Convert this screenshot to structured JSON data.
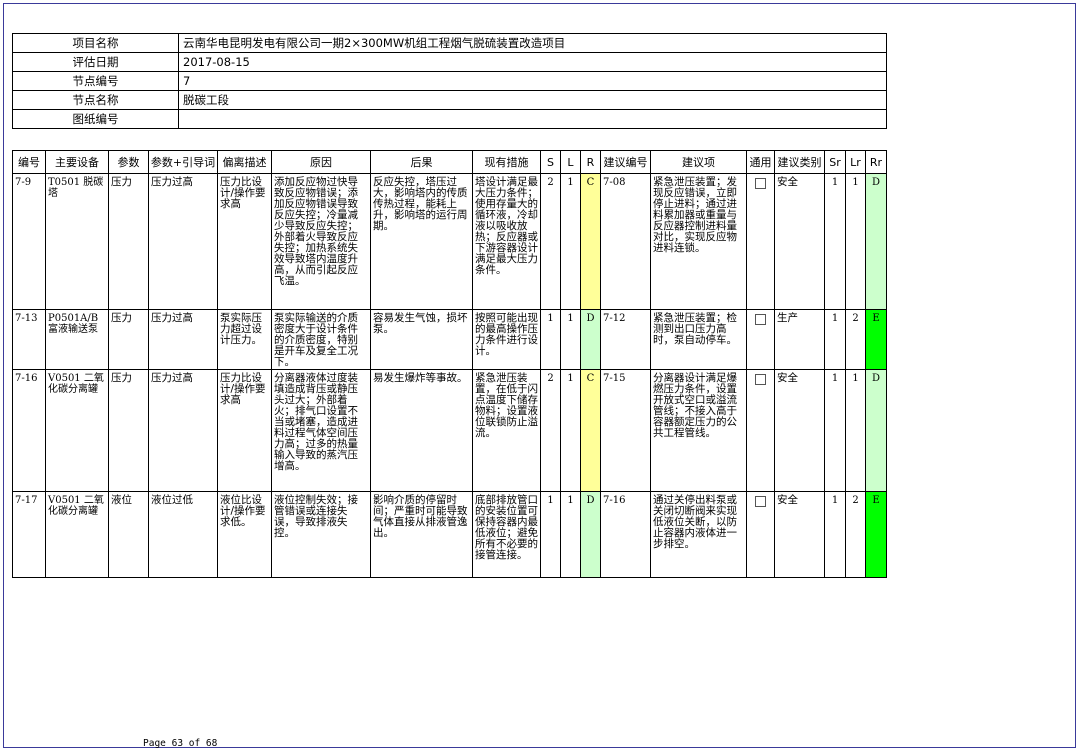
{
  "project": {
    "name_label": "项目名称",
    "name": "云南华电昆明发电有限公司一期2×300MW机组工程烟气脱硫装置改造项目",
    "date_label": "评估日期",
    "date": "2017-08-15",
    "node_no_label": "节点编号",
    "node_no": "7",
    "node_name_label": "节点名称",
    "node_name": "脱碳工段",
    "drawing_label": "图纸编号",
    "drawing": ""
  },
  "columns": [
    "编号",
    "主要设备",
    "参数",
    "参数+引导词",
    "偏离描述",
    "原因",
    "后果",
    "现有措施",
    "S",
    "L",
    "R",
    "建议编号",
    "建议项",
    "通用",
    "建议类别",
    "Sr",
    "Lr",
    "Rr"
  ],
  "rows": [
    {
      "id": "7-9",
      "equipment": "T0501 脱碳塔",
      "param": "压力",
      "param_guide": "压力过高",
      "deviation": "压力比设计/操作要求高",
      "cause": "添加反应物过快导致反应物错误；添加反应物错误导致反应失控；冷量减少导致反应失控；外部着火导致反应失控；加热系统失效导致塔内温度升高，从而引起反应飞温。",
      "consequence": "反应失控，塔压过大，影响塔内的传质传热过程，能耗上升，影响塔的运行周期。",
      "safeguards": "塔设计满足最大压力条件；使用存量大的循环液，冷却液以吸收放热；反应器或下游容器设计满足最大压力条件。",
      "s": "2",
      "l": "1",
      "r": "C",
      "rec_id": "7-08",
      "recommendation": "紧急泄压装置；发现反应错误，立即停止进料；通过进料累加器或重量与反应器控制进料量对比，实现反应物进料连锁。",
      "category": "安全",
      "sr": "1",
      "lr": "1",
      "rr": "D"
    },
    {
      "id": "7-13",
      "equipment": "P0501A/B富液输送泵",
      "param": "压力",
      "param_guide": "压力过高",
      "deviation": "泵实际压力超过设计压力。",
      "cause": "泵实际输送的介质密度大于设计条件的介质密度，特别是开车及复全工况下。",
      "consequence": "容易发生气蚀，损坏泵。",
      "safeguards": "按照可能出现的最高操作压力条件进行设计。",
      "s": "1",
      "l": "1",
      "r": "D",
      "rec_id": "7-12",
      "recommendation": "紧急泄压装置；检测到出口压力高时，泵自动停车。",
      "category": "生产",
      "sr": "1",
      "lr": "2",
      "rr": "E"
    },
    {
      "id": "7-16",
      "equipment": "V0501 二氧化碳分离罐",
      "param": "压力",
      "param_guide": "压力过高",
      "deviation": "压力比设计/操作要求高",
      "cause": "分离器液体过度装填造成背压或静压头过大；外部着火；排气口设置不当或堵塞，造成进料过程气体空间压力高；过多的热量输入导致的蒸汽压增高。",
      "consequence": "易发生爆炸等事故。",
      "safeguards": "紧急泄压装置，在低于闪点温度下储存物料；设置液位联锁防止溢流。",
      "s": "2",
      "l": "1",
      "r": "C",
      "rec_id": "7-15",
      "recommendation": "分离器设计满足爆燃压力条件，设置开放式空口或溢流管线；不接入高于容器额定压力的公共工程管线。",
      "category": "安全",
      "sr": "1",
      "lr": "1",
      "rr": "D"
    },
    {
      "id": "7-17",
      "equipment": "V0501 二氧化碳分离罐",
      "param": "液位",
      "param_guide": "液位过低",
      "deviation": "液位比设计/操作要求低。",
      "cause": "液位控制失效；接管错误或连接失误，导致排液失控。",
      "consequence": "影响介质的停留时间；严重时可能导致气体直接从排液管逸出。",
      "safeguards": "底部排放管口的安装位置可保持容器内最低液位；避免所有不必要的接管连接。",
      "s": "1",
      "l": "1",
      "r": "D",
      "rec_id": "7-16",
      "recommendation": "通过关停出料泵或关闭切断阀来实现低液位关断，以防止容器内液体进一步排空。",
      "category": "安全",
      "sr": "1",
      "lr": "2",
      "rr": "E"
    }
  ],
  "footer": "Page 63 of 68"
}
